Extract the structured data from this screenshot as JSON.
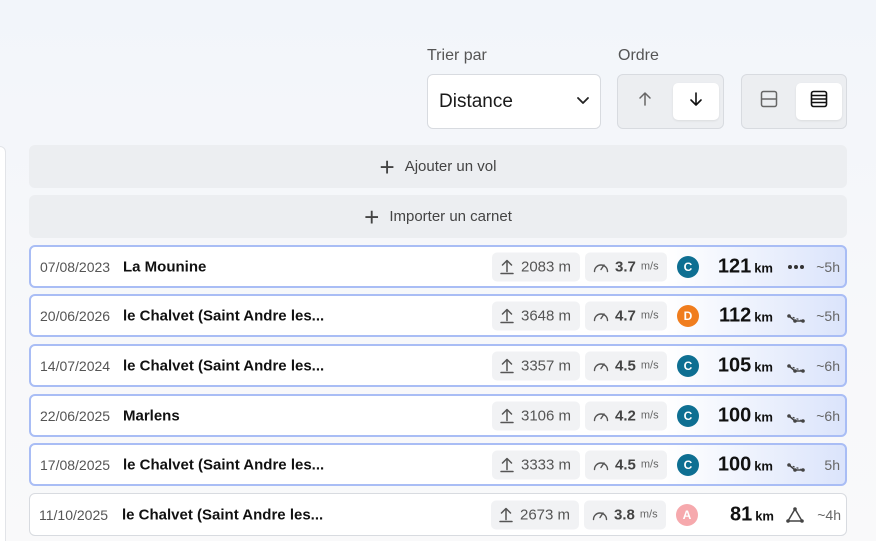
{
  "controls": {
    "sort_label": "Trier par",
    "sort_value": "Distance",
    "order_label": "Ordre"
  },
  "actions": {
    "add_flight": "Ajouter un vol",
    "import_logbook": "Importer un carnet"
  },
  "colors": {
    "C": "#0e6f92",
    "D": "#f07d1e",
    "A": "#f6a9ad"
  },
  "flights": [
    {
      "date": "07/08/2023",
      "site": "La Mounine",
      "altitude": "2083 m",
      "vario": "3.7",
      "vario_unit": "m/s",
      "badge": "C",
      "distance": "121",
      "distance_unit": "km",
      "type_icon": "dots-icon",
      "duration": "~5h",
      "highlighted": true
    },
    {
      "date": "20/06/2026",
      "site": "le Chalvet (Saint Andre les...",
      "altitude": "3648 m",
      "vario": "4.7",
      "vario_unit": "m/s",
      "badge": "D",
      "distance": "112",
      "distance_unit": "km",
      "type_icon": "triangle-icon",
      "duration": "~5h",
      "highlighted": true
    },
    {
      "date": "14/07/2024",
      "site": "le Chalvet (Saint Andre les...",
      "altitude": "3357 m",
      "vario": "4.5",
      "vario_unit": "m/s",
      "badge": "C",
      "distance": "105",
      "distance_unit": "km",
      "type_icon": "triangle-icon",
      "duration": "~6h",
      "highlighted": true
    },
    {
      "date": "22/06/2025",
      "site": "Marlens",
      "altitude": "3106 m",
      "vario": "4.2",
      "vario_unit": "m/s",
      "badge": "C",
      "distance": "100",
      "distance_unit": "km",
      "type_icon": "triangle-icon",
      "duration": "~6h",
      "highlighted": true
    },
    {
      "date": "17/08/2025",
      "site": "le Chalvet (Saint Andre les...",
      "altitude": "3333 m",
      "vario": "4.5",
      "vario_unit": "m/s",
      "badge": "C",
      "distance": "100",
      "distance_unit": "km",
      "type_icon": "triangle-icon",
      "duration": "5h",
      "highlighted": true
    },
    {
      "date": "11/10/2025",
      "site": "le Chalvet (Saint Andre les...",
      "altitude": "2673 m",
      "vario": "3.8",
      "vario_unit": "m/s",
      "badge": "A",
      "distance": "81",
      "distance_unit": "km",
      "type_icon": "triangle-closed-icon",
      "duration": "~4h",
      "highlighted": false
    }
  ]
}
